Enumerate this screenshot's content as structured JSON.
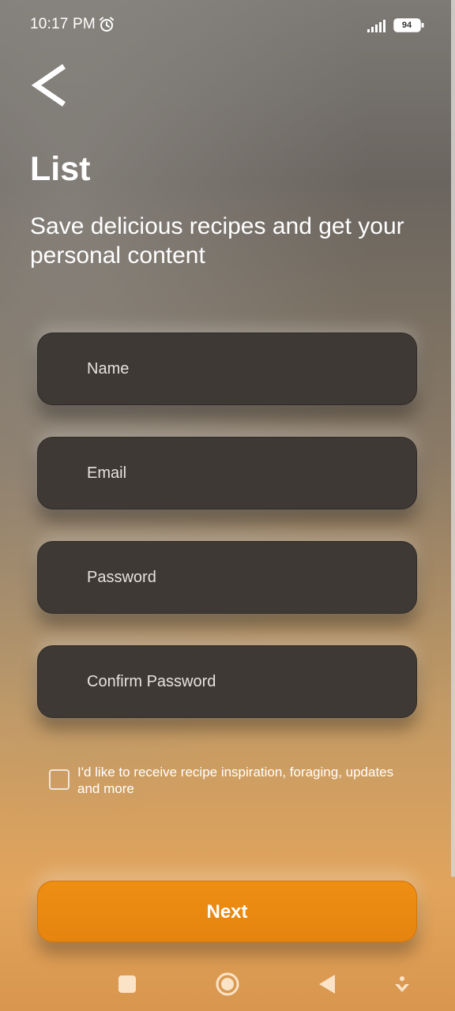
{
  "status_bar": {
    "time": "10:17 PM",
    "battery": "94"
  },
  "header": {
    "title": "List",
    "subtitle": "Save delicious recipes and get your personal content"
  },
  "form": {
    "name_placeholder": "Name",
    "email_placeholder": "Email",
    "password_placeholder": "Password",
    "confirm_password_placeholder": "Confirm Password",
    "consent_label": "I'd like to receive recipe inspiration, foraging, updates and more",
    "consent_checked": false
  },
  "actions": {
    "next_label": "Next"
  },
  "colors": {
    "accent": "#EA8A11",
    "field_background": "#3E3935"
  },
  "icons": {
    "back": "chevron-left-icon",
    "alarm": "alarm-icon",
    "signal": "signal-icon",
    "battery": "battery-icon"
  }
}
